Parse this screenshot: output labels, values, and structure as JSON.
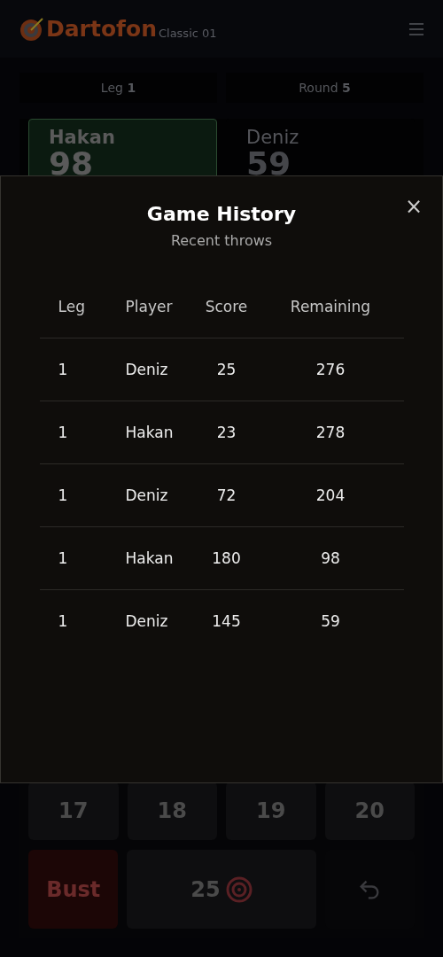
{
  "header": {
    "brand": "Dartofon",
    "mode": "Classic 01"
  },
  "info": [
    {
      "label": "Leg",
      "value": "1"
    },
    {
      "label": "Round",
      "value": "5"
    }
  ],
  "players": [
    {
      "name": "Hakan",
      "score": "98",
      "selected": true
    },
    {
      "name": "Deniz",
      "score": "59",
      "selected": false
    }
  ],
  "keypad": {
    "numbers": [
      "17",
      "18",
      "19",
      "20"
    ],
    "bust": "Bust",
    "bull": "25"
  },
  "modal": {
    "title": "Game History",
    "subtitle": "Recent throws",
    "close": "×",
    "columns": [
      "Leg",
      "Player",
      "Score",
      "Remaining"
    ],
    "rows": [
      [
        "1",
        "Deniz",
        "25",
        "276"
      ],
      [
        "1",
        "Hakan",
        "23",
        "278"
      ],
      [
        "1",
        "Deniz",
        "72",
        "204"
      ],
      [
        "1",
        "Hakan",
        "180",
        "98"
      ],
      [
        "1",
        "Deniz",
        "145",
        "59"
      ]
    ]
  }
}
